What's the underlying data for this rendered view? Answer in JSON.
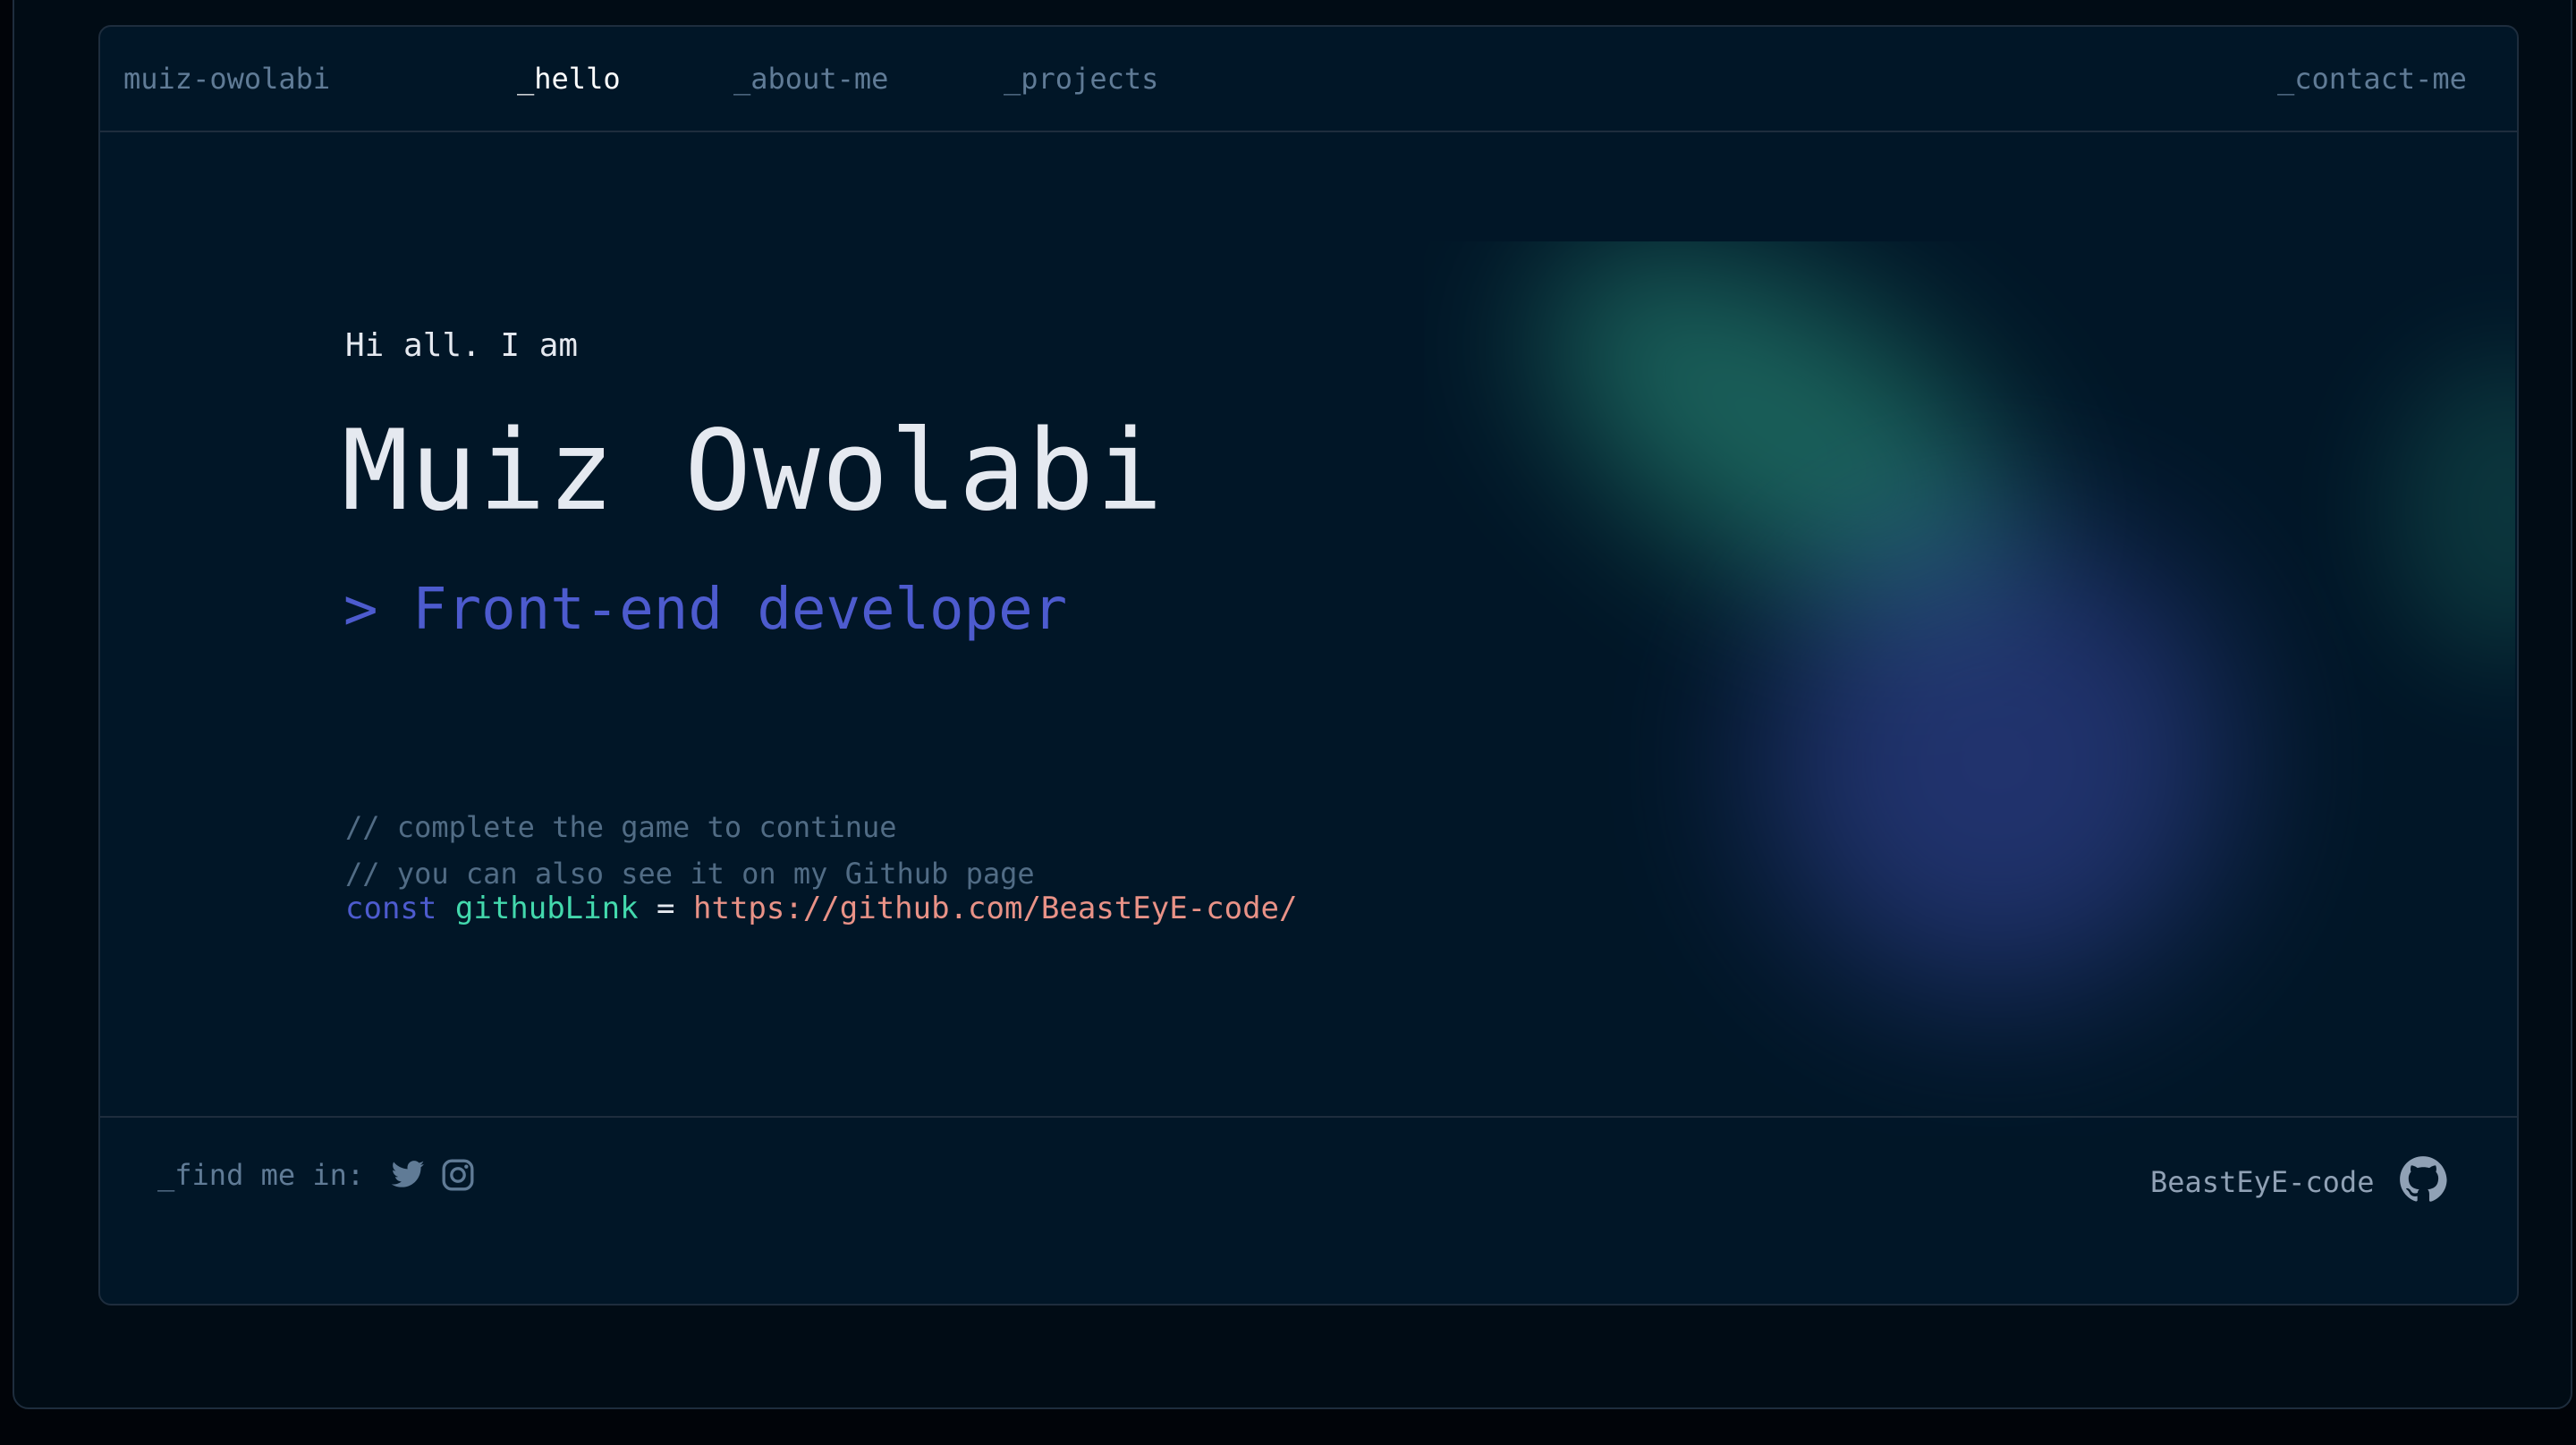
{
  "header": {
    "brand": "muiz-owolabi",
    "nav": [
      {
        "label": "_hello"
      },
      {
        "label": "_about-me"
      },
      {
        "label": "_projects"
      }
    ],
    "contact": "_contact-me"
  },
  "hero": {
    "greeting": "Hi all. I am",
    "name": "Muiz Owolabi",
    "role": "> Front-end developer",
    "comments": [
      "// complete the game to continue",
      "// you can also see it on my Github page"
    ],
    "code": {
      "keyword": "const",
      "variable": "githubLink",
      "operator": "=",
      "value": "https://github.com/BeastEyE-code/"
    }
  },
  "footer": {
    "find_me": "_find me in:",
    "social_icons": [
      "twitter-icon",
      "instagram-icon"
    ],
    "github_username": "BeastEyE-code",
    "github_icon": "github-icon"
  },
  "colors": {
    "background": "#011627",
    "border": "#1e2d3d",
    "muted_text": "#607b96",
    "accent_blue": "#4d5bce",
    "accent_green": "#43d9ad",
    "accent_orange": "#e99287"
  }
}
